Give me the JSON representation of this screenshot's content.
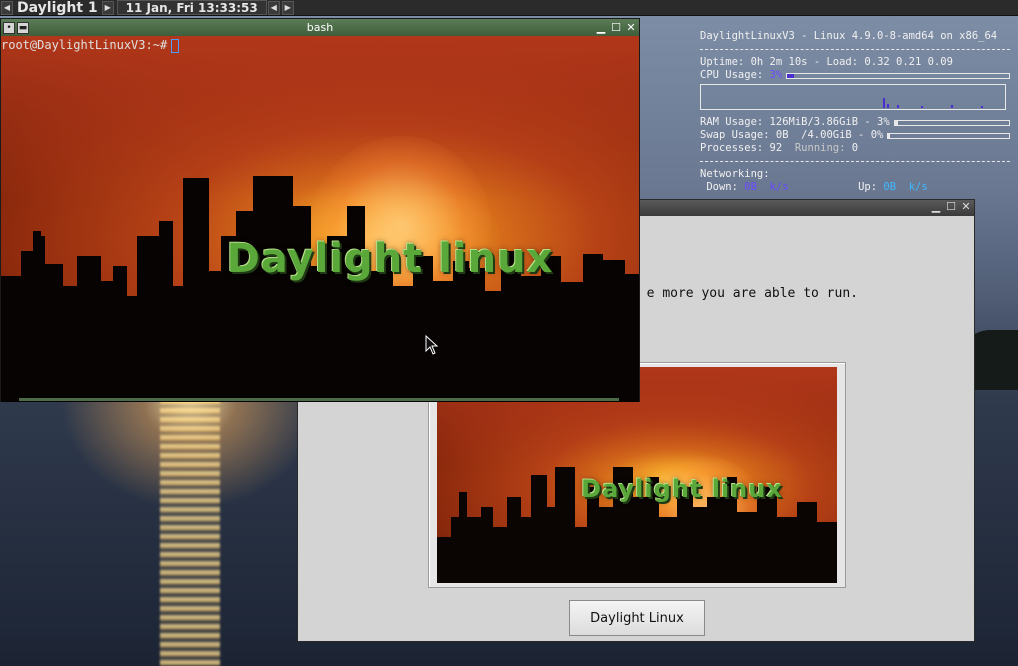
{
  "panel": {
    "desktop_name": "Daylight 1",
    "clock": "11 Jan, Fri 13:33:53",
    "icons": [
      "arrow-left-icon",
      "arrow-right-icon",
      "arrow-left-icon",
      "arrow-right-icon"
    ]
  },
  "conky": {
    "header": "DaylightLinuxV3 - Linux 4.9.0-8-amd64 on x86_64",
    "uptime_label": "Uptime:",
    "uptime": "0h 2m 10s",
    "load_label": "- Load:",
    "load": "0.32 0.21 0.09",
    "cpu_label": "CPU Usage:",
    "cpu_value": "3%",
    "cpu_fraction": 0.03,
    "ram_label": "RAM Usage:",
    "ram_value": "126MiB/3.86GiB - 3%",
    "ram_fraction": 0.03,
    "swap_label": "Swap Usage:",
    "swap_value": "0B  /4.00GiB - 0%",
    "swap_fraction": 0.0,
    "processes_label": "Processes:",
    "processes": "92",
    "running_label": "Running:",
    "running": "0",
    "networking_label": "Networking:",
    "down_label": "Down:",
    "down_value": "0B",
    "down_unit": "k/s",
    "up_label": "Up:",
    "up_value": "0B",
    "up_unit": "k/s",
    "colors": {
      "accent": "#4a2fd0",
      "net": "#3fb8ff"
    }
  },
  "terminal": {
    "title": "bash",
    "prompt": "root@DaylightLinuxV3:~#",
    "background_logo": "Daylight linux"
  },
  "dialog": {
    "text": "e more you are able to run.",
    "image_logo": "Daylight linux",
    "button_label": "Daylight Linux"
  }
}
